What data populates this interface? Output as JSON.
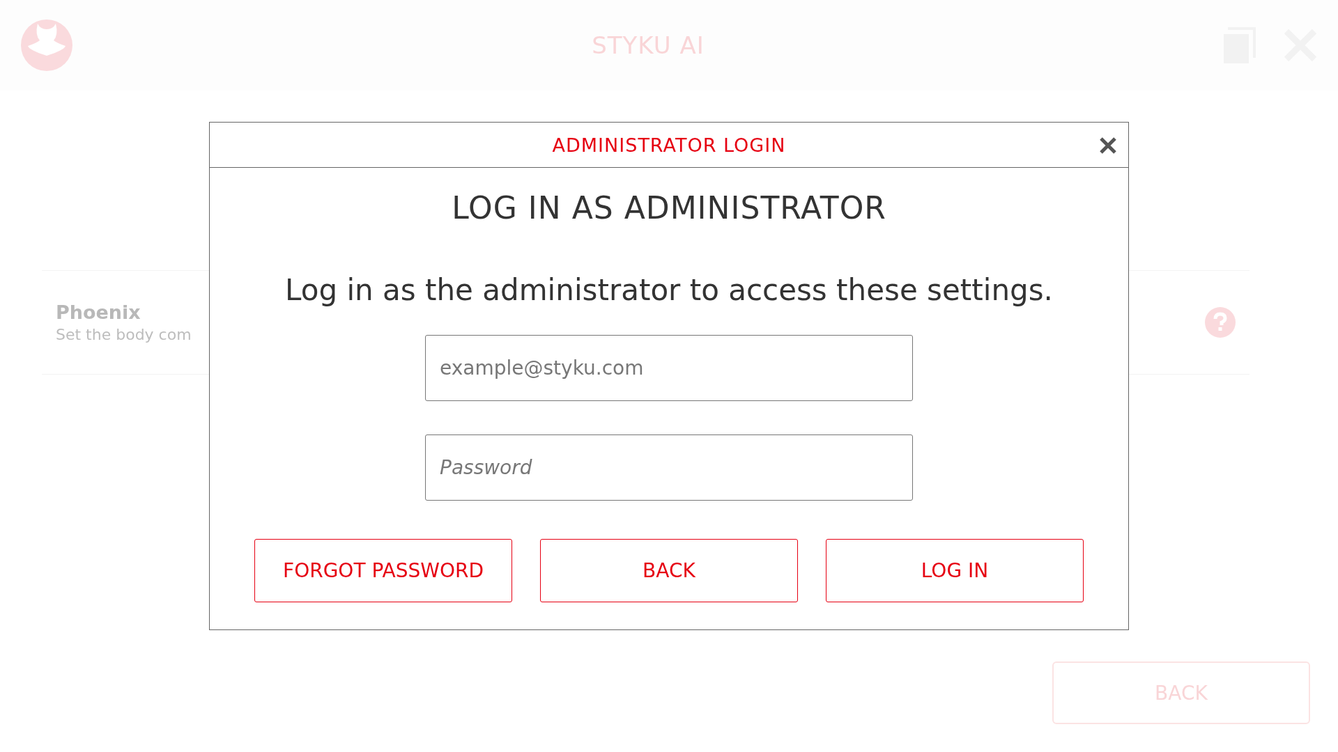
{
  "top_bar": {
    "title": "STYKU AI"
  },
  "settings_row": {
    "title": "Phoenix",
    "subtitle": "Set the body com"
  },
  "back_button": "BACK",
  "dialog": {
    "title": "ADMINISTRATOR LOGIN",
    "heading": "LOG IN AS ADMINISTRATOR",
    "message": "Log in as the administrator to access these settings.",
    "fields": [
      {
        "kind": "email",
        "placeholder": "example@styku.com"
      },
      {
        "kind": "password",
        "placeholder": "Password"
      }
    ],
    "buttons": [
      "FORGOT PASSWORD",
      "BACK",
      "LOG IN"
    ]
  }
}
